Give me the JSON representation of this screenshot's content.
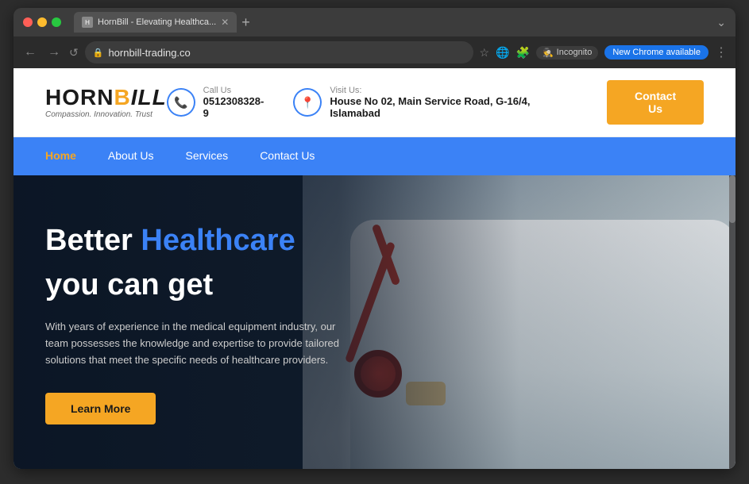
{
  "browser": {
    "tab_title": "HornBill - Elevating Healthca...",
    "url": "hornbill-trading.co",
    "new_tab_btn": "+",
    "expand_btn": "⌄",
    "incognito_label": "Incognito",
    "chrome_update_label": "New Chrome available",
    "nav": {
      "back": "←",
      "forward": "→",
      "refresh": "↺"
    }
  },
  "site": {
    "logo": {
      "text_horn": "HORN",
      "text_b": "B",
      "text_ill": "ILL",
      "tagline": "Compassion. Innovation. Trust"
    },
    "header": {
      "call_label": "Call Us",
      "call_number": "0512308328-9",
      "visit_label": "Visit Us:",
      "visit_address": "House No 02, Main Service Road, G-16/4, Islamabad",
      "contact_btn": "Contact Us"
    },
    "nav": {
      "items": [
        {
          "label": "Home",
          "active": true
        },
        {
          "label": "About Us",
          "active": false
        },
        {
          "label": "Services",
          "active": false
        },
        {
          "label": "Contact Us",
          "active": false
        }
      ]
    },
    "hero": {
      "title_normal": "Better",
      "title_highlight": "Healthcare",
      "subtitle": "you can get",
      "description": "With years of experience in the medical equipment industry, our team possesses the knowledge and expertise to provide tailored solutions that meet the specific needs of healthcare providers.",
      "cta_btn": "Learn More"
    }
  }
}
